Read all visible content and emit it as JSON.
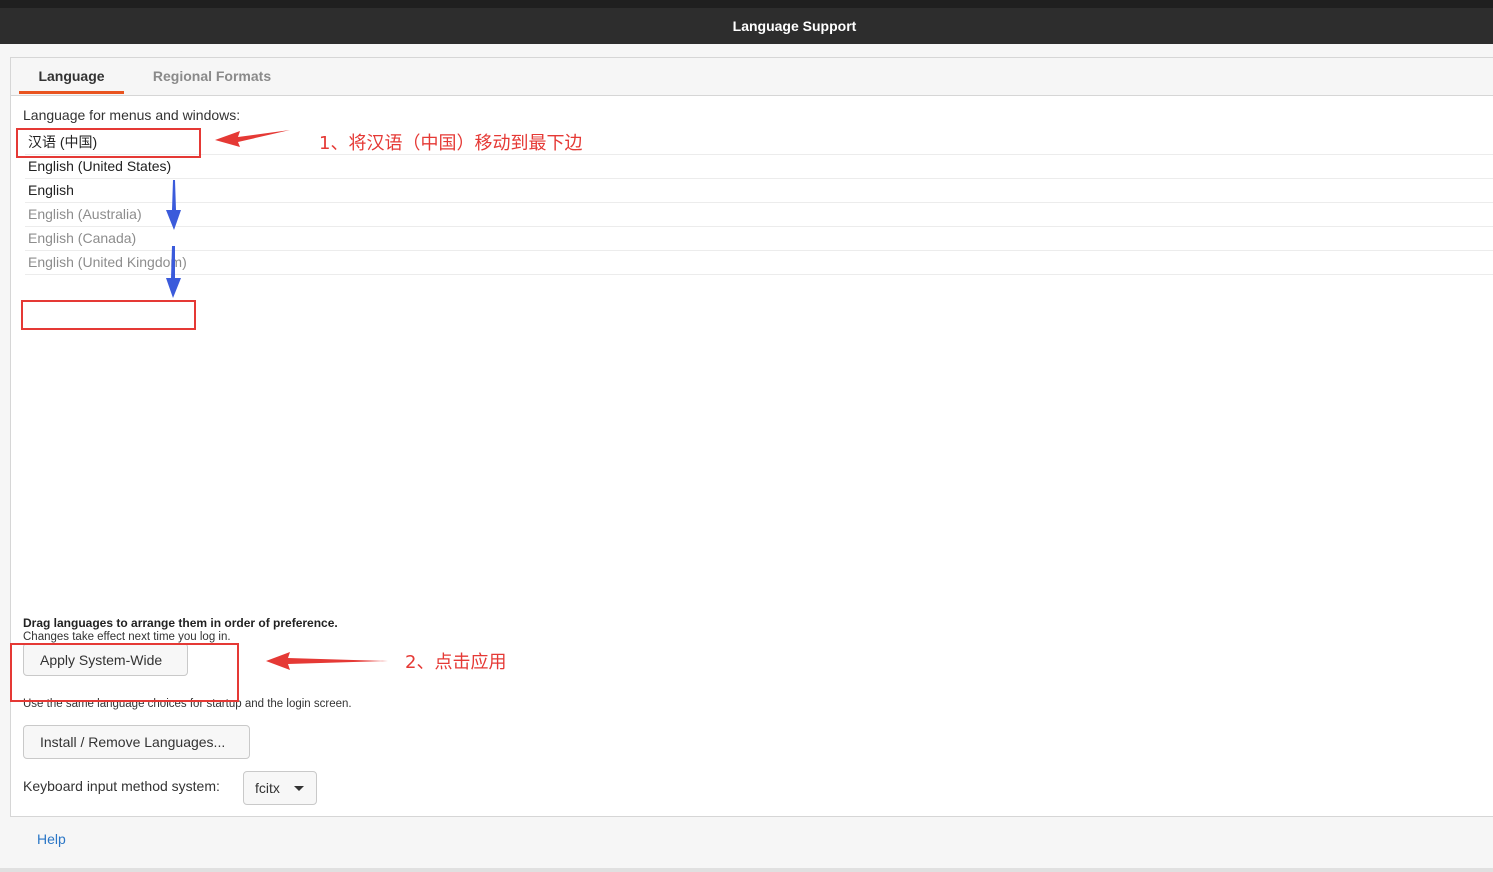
{
  "window": {
    "title": "Language Support"
  },
  "tabs": [
    {
      "label": "Language"
    },
    {
      "label": "Regional Formats"
    }
  ],
  "language_tab": {
    "menus_label": "Language for menus and windows:",
    "languages": [
      {
        "label": "汉语 (中国)",
        "enabled": true
      },
      {
        "label": "English (United States)",
        "enabled": true
      },
      {
        "label": "English",
        "enabled": true
      },
      {
        "label": "English (Australia)",
        "enabled": false
      },
      {
        "label": "English (Canada)",
        "enabled": false
      },
      {
        "label": "English (United Kingdom)",
        "enabled": false
      }
    ],
    "drag_hint": "Drag languages to arrange them in order of preference.",
    "changes_hint": "Changes take effect next time you log in.",
    "apply_button": "Apply System-Wide",
    "apply_note": "Use the same language choices for startup and the login screen.",
    "install_button": "Install / Remove Languages...",
    "keyboard_label": "Keyboard input method system:",
    "keyboard_value": "fcitx"
  },
  "help": "Help",
  "annotations": {
    "step1": "1、将汉语（中国）移动到最下边",
    "step2": "2、点击应用",
    "color": "#e53935",
    "arrow_down_color": "#3b5bdb"
  }
}
